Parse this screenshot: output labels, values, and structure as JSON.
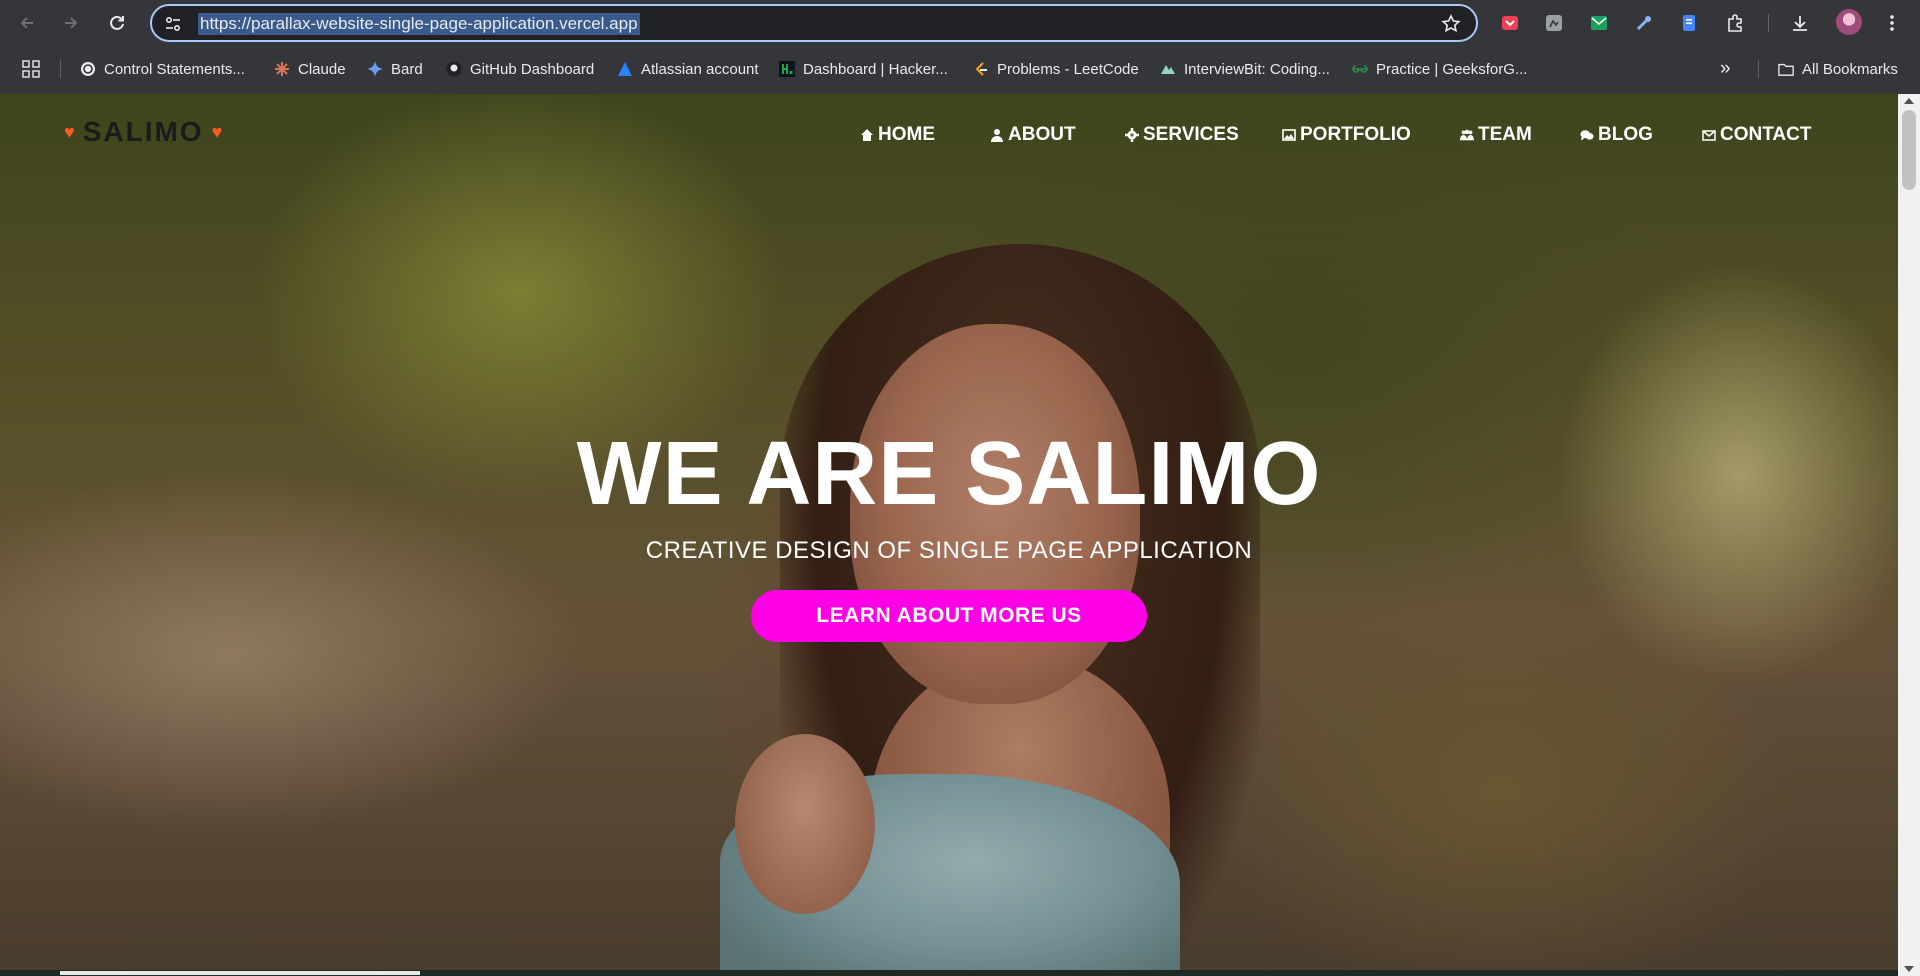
{
  "browser": {
    "url": "https://parallax-website-single-page-application.vercel.app",
    "bookmarks": [
      {
        "label": "Control Statements...",
        "icon": "openai-icon"
      },
      {
        "label": "Claude",
        "icon": "claude-icon"
      },
      {
        "label": "Bard",
        "icon": "bard-icon"
      },
      {
        "label": "GitHub Dashboard",
        "icon": "github-icon"
      },
      {
        "label": "Atlassian account",
        "icon": "atlassian-icon"
      },
      {
        "label": "Dashboard | Hacker...",
        "icon": "hackerrank-icon"
      },
      {
        "label": "Problems - LeetCode",
        "icon": "leetcode-icon"
      },
      {
        "label": "InterviewBit: Coding...",
        "icon": "interviewbit-icon"
      },
      {
        "label": "Practice | GeeksforG...",
        "icon": "geeksforgeeks-icon"
      }
    ],
    "all_bookmarks_label": "All Bookmarks",
    "more_bookmarks_label": "»"
  },
  "site": {
    "logo": "SALIMO",
    "accent_color": "#ff00e6",
    "logo_heart_color": "#ff5a1f",
    "nav": [
      {
        "label": "HOME",
        "icon": "home-icon"
      },
      {
        "label": "ABOUT",
        "icon": "user-icon"
      },
      {
        "label": "SERVICES",
        "icon": "gear-icon"
      },
      {
        "label": "PORTFOLIO",
        "icon": "image-icon"
      },
      {
        "label": "TEAM",
        "icon": "team-icon"
      },
      {
        "label": "BLOG",
        "icon": "chat-icon"
      },
      {
        "label": "CONTACT",
        "icon": "mail-icon"
      }
    ],
    "hero": {
      "title": "WE ARE SALIMO",
      "subtitle": "CREATIVE DESIGN OF SINGLE PAGE APPLICATION",
      "button": "LEARN ABOUT MORE US"
    }
  }
}
